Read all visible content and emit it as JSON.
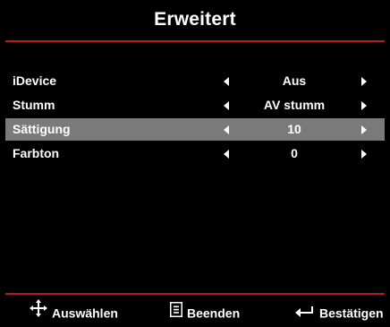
{
  "title": "Erweitert",
  "rows": [
    {
      "label": "iDevice",
      "value": "Aus"
    },
    {
      "label": "Stumm",
      "value": "AV stumm"
    },
    {
      "label": "Sättigung",
      "value": "10"
    },
    {
      "label": "Farbton",
      "value": "0"
    }
  ],
  "selected_row": 2,
  "footer": {
    "select_label": "Auswählen",
    "exit_label": "Beenden",
    "confirm_label": "Bestätigen"
  },
  "colors": {
    "background": "#000000",
    "accent_rule": "#b51a1f",
    "selected_row": "#7a7a7a",
    "text": "#ffffff"
  }
}
